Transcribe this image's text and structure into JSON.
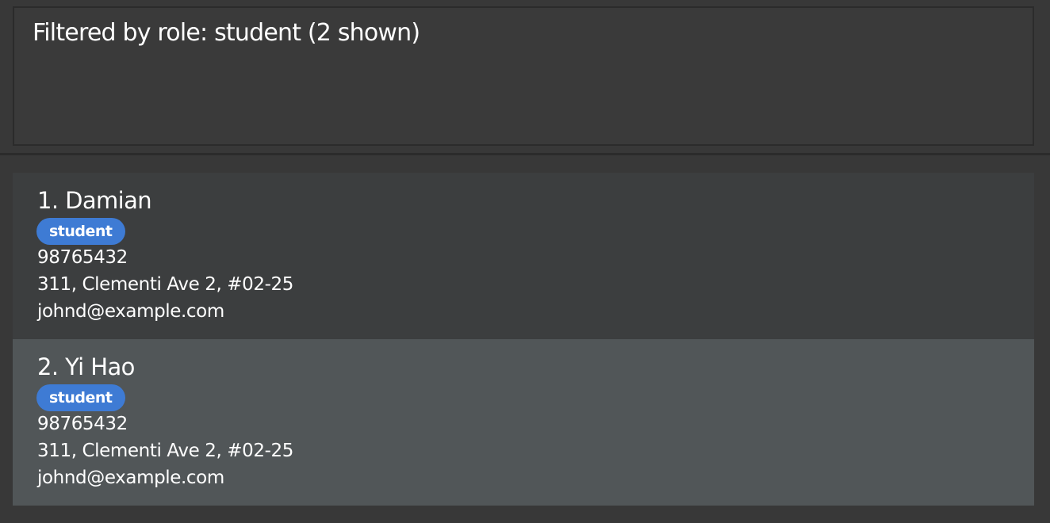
{
  "result_display": {
    "message": "Filtered by role: student (2 shown)"
  },
  "persons": [
    {
      "index_name": "1. Damian",
      "tag": "student",
      "phone": "98765432",
      "address": "311, Clementi Ave 2, #02-25",
      "email": "johnd@example.com"
    },
    {
      "index_name": "2. Yi Hao",
      "tag": "student",
      "phone": "98765432",
      "address": "311, Clementi Ave 2, #02-25",
      "email": "johnd@example.com"
    }
  ],
  "colors": {
    "tag_background": "#3e7bd4",
    "selected_card_background": "#515658",
    "card_background": "#3c3e3f"
  }
}
